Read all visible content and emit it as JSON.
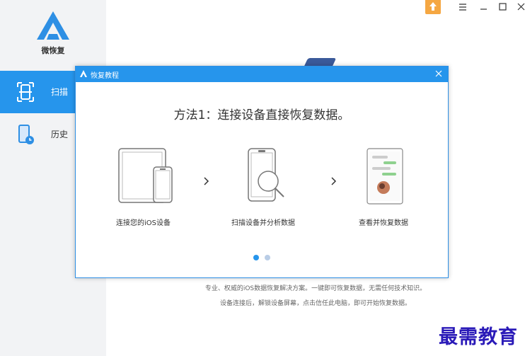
{
  "app": {
    "name": "微恢复",
    "brand_color": "#2695ec"
  },
  "sidebar": {
    "items": [
      {
        "label": "扫描",
        "icon": "scan-icon",
        "active": true
      },
      {
        "label": "历史",
        "icon": "phone-history-icon",
        "active": false
      }
    ]
  },
  "window_controls": {
    "icons": [
      "upload-icon",
      "menu-icon",
      "minimize-icon",
      "maximize-icon",
      "close-icon"
    ]
  },
  "background": {
    "line1": "专业、权威的iOS数据恢复解决方案。一键即可恢复数据，无需任何技术知识。",
    "line2": "设备连接后，解锁设备屏幕，点击信任此电脑，即可开始恢复数据。"
  },
  "watermark": "最需教育",
  "dialog": {
    "title": "恢复教程",
    "heading": "方法1：连接设备直接恢复数据。",
    "steps": [
      {
        "label": "连接您的iOS设备",
        "icon": "ipad-iphone-icon"
      },
      {
        "label": "扫描设备并分析数据",
        "icon": "phone-magnifier-icon"
      },
      {
        "label": "查看并恢复数据",
        "icon": "phone-chat-icon"
      }
    ],
    "pagination": {
      "current": 1,
      "total": 2
    }
  }
}
